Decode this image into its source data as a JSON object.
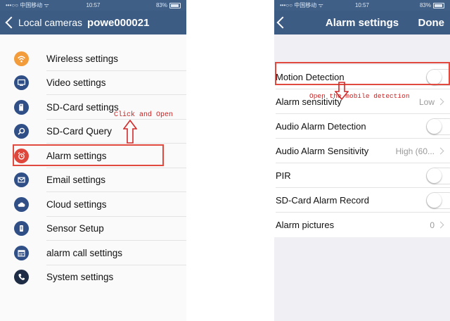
{
  "left_phone": {
    "status": {
      "carrier": "•••○○ 中国移动 ᯤ",
      "time": "10:57",
      "battery": "83%"
    },
    "nav": {
      "back_label": "Local cameras",
      "title": "powe000021"
    },
    "menu": [
      {
        "label": "Wireless settings",
        "icon": "wifi-icon",
        "color": "#f39c3c"
      },
      {
        "label": "Video settings",
        "icon": "monitor-icon",
        "color": "#2f4f86"
      },
      {
        "label": "SD-Card settings",
        "icon": "sd-card-icon",
        "color": "#2f4f86"
      },
      {
        "label": "SD-Card Query",
        "icon": "magnifier-icon",
        "color": "#2f4f86"
      },
      {
        "label": "Alarm settings",
        "icon": "alarm-clock-icon",
        "color": "#e0473c"
      },
      {
        "label": "Email settings",
        "icon": "envelope-icon",
        "color": "#2f4f86"
      },
      {
        "label": "Cloud settings",
        "icon": "cloud-icon",
        "color": "#2f4f86"
      },
      {
        "label": "Sensor Setup",
        "icon": "sensor-icon",
        "color": "#2f4f86"
      },
      {
        "label": "alarm call settings",
        "icon": "calendar-icon",
        "color": "#2f4f86"
      },
      {
        "label": "System settings",
        "icon": "phone-icon",
        "color": "#1e2d45"
      }
    ],
    "annotation": "Click and Open"
  },
  "right_phone": {
    "status": {
      "carrier": "•••○○ 中国移动 ᯤ",
      "time": "10:57",
      "battery": "83%"
    },
    "nav": {
      "title": "Alarm settings",
      "done_label": "Done"
    },
    "rows": [
      {
        "label": "Motion Detection",
        "type": "toggle"
      },
      {
        "label": "Alarm sensitivity",
        "value": "Low",
        "type": "value"
      },
      {
        "label": "Audio Alarm Detection",
        "type": "toggle"
      },
      {
        "label": "Audio Alarm Sensitivity",
        "value": "High (60...",
        "type": "value"
      },
      {
        "label": "PIR",
        "type": "toggle"
      },
      {
        "label": "SD-Card Alarm Record",
        "type": "toggle"
      },
      {
        "label": "Alarm pictures",
        "value": "0",
        "type": "value"
      }
    ],
    "annotation": "Open the mobile detection"
  },
  "colors": {
    "nav_bar": "#3d5c84",
    "highlight": "#e04a3f",
    "annotation": "#cc2020"
  }
}
